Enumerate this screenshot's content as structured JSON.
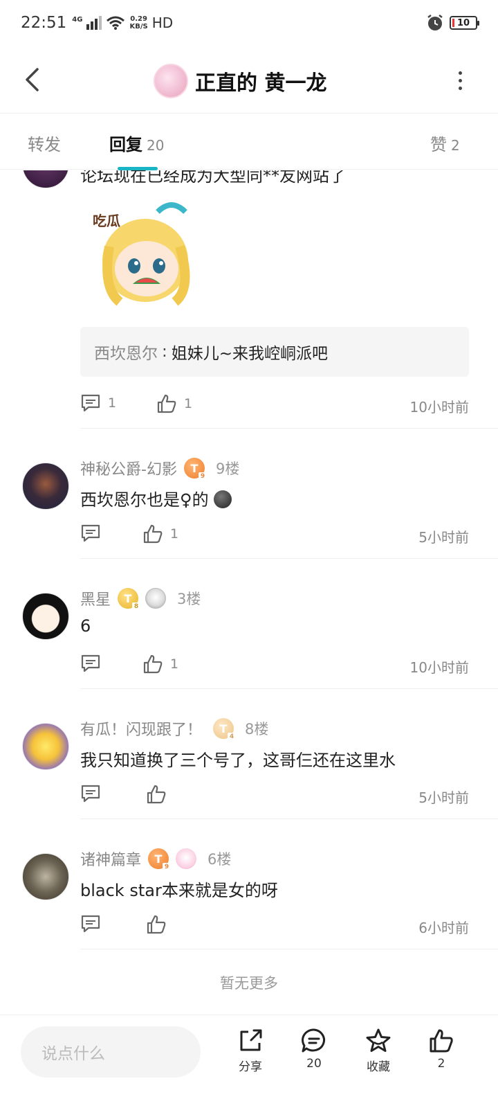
{
  "status_bar": {
    "time": "22:51",
    "network": "4G",
    "speed_value": "0.29",
    "speed_unit": "KB/S",
    "hd": "HD",
    "battery": "10"
  },
  "header": {
    "title": "正直的 黄一龙"
  },
  "tabs": [
    {
      "label": "转发",
      "count": ""
    },
    {
      "label": "回复",
      "count": "20"
    },
    {
      "label": "赞",
      "count": "2"
    }
  ],
  "top_comment": {
    "text": "论坛现在已经成为大型同**友网站了",
    "quote_name": "西坎恩尔",
    "quote_sep": ":",
    "quote_text": "姐妹儿~来我崆峒派吧",
    "reply_count": "1",
    "like_count": "1",
    "time": "10小时前"
  },
  "comments": [
    {
      "name": "神秘公爵-幻影",
      "level": "9",
      "floor": "9楼",
      "text": "西坎恩尔也是♀的",
      "like_count": "1",
      "time": "5小时前"
    },
    {
      "name": "黑星",
      "level": "8",
      "floor": "3楼",
      "text": "6",
      "like_count": "1",
      "time": "10小时前"
    },
    {
      "name": "有瓜！闪现跟了！",
      "level": "4",
      "floor": "8楼",
      "text": "我只知道换了三个号了，这哥仨还在这里水",
      "like_count": "",
      "time": "5小时前"
    },
    {
      "name": "诸神篇章",
      "level": "9",
      "floor": "6楼",
      "text": "black star本来就是女的呀",
      "like_count": "",
      "time": "6小时前"
    }
  ],
  "footer": {
    "no_more": "暂无更多"
  },
  "bottom_bar": {
    "placeholder": "说点什么",
    "share_label": "分享",
    "comment_count": "20",
    "favorite_label": "收藏",
    "like_count": "2"
  },
  "colors": {
    "accent": "#19b5c6",
    "badge_orange": "#ee7e2a",
    "badge_gold": "#e8b227"
  }
}
